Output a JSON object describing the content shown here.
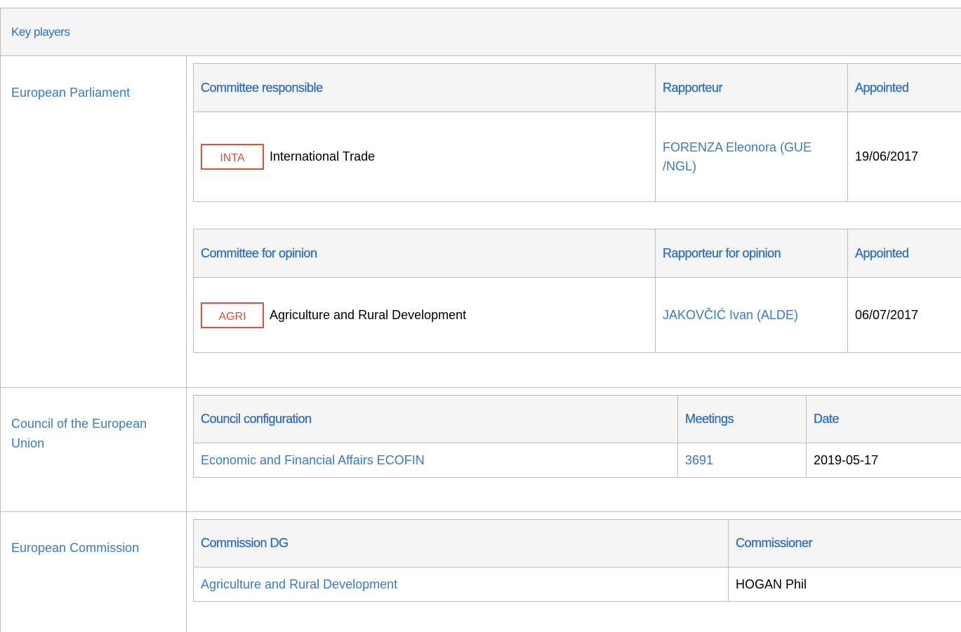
{
  "header": {
    "title": "Key players"
  },
  "parliament": {
    "label": "European Parliament",
    "responsible": {
      "headers": [
        "Committee responsible",
        "Rapporteur",
        "Appointed"
      ],
      "row": {
        "badge": "INTA",
        "committee": "International Trade",
        "rapporteur": "FORENZA Eleonora (GUE /NGL)",
        "date": "19/06/2017"
      }
    },
    "opinion": {
      "headers": [
        "Committee for opinion",
        "Rapporteur for opinion",
        "Appointed"
      ],
      "row": {
        "badge": "AGRI",
        "committee": "Agriculture and Rural Development",
        "rapporteur": "JAKOVČIĆ Ivan (ALDE)",
        "date": "06/07/2017"
      }
    }
  },
  "council": {
    "label": "Council of the European Union",
    "headers": [
      "Council configuration",
      "Meetings",
      "Date"
    ],
    "row": {
      "configuration": "Economic and Financial Affairs ECOFIN",
      "meeting": "3691",
      "date": "2019-05-17"
    }
  },
  "commission": {
    "label": "European Commission",
    "headers": [
      "Commission DG",
      "Commissioner"
    ],
    "row": {
      "dg": "Agriculture and Rural Development",
      "commissioner": "HOGAN Phil"
    }
  },
  "colors": {
    "link": "#3a7bc8",
    "badge": "#e0513a",
    "border": "#bdbdbd",
    "header_bg": "#f5f5f5"
  }
}
